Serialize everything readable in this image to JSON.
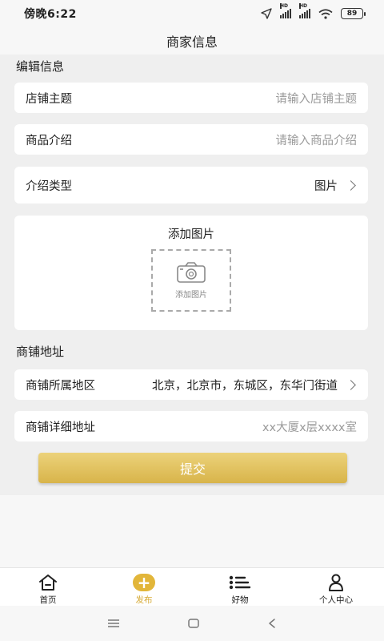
{
  "status_bar": {
    "time": "傍晚6:22",
    "battery": "89"
  },
  "header": {
    "title": "商家信息"
  },
  "edit_section": {
    "label": "编辑信息",
    "store_theme": {
      "label": "店铺主题",
      "placeholder": "请输入店铺主题"
    },
    "product_intro": {
      "label": "商品介绍",
      "placeholder": "请输入商品介绍"
    },
    "intro_type": {
      "label": "介绍类型",
      "value": "图片"
    },
    "add_image": {
      "title": "添加图片",
      "button_label": "添加图片"
    }
  },
  "address_section": {
    "label": "商铺地址",
    "region": {
      "label": "商铺所属地区",
      "value": "北京，北京市，东城区，东华门街道"
    },
    "detail": {
      "label": "商铺详细地址",
      "placeholder": "xx大厦x层xxxx室"
    }
  },
  "submit_label": "提交",
  "tabs": [
    {
      "label": "首页",
      "icon": "home-icon",
      "active": false
    },
    {
      "label": "发布",
      "icon": "plus-icon",
      "active": true
    },
    {
      "label": "好物",
      "icon": "list-icon",
      "active": false
    },
    {
      "label": "个人中心",
      "icon": "person-icon",
      "active": false
    }
  ],
  "colors": {
    "accent": "#d6a933",
    "button": "#e0bf5a",
    "background": "#efefef"
  }
}
